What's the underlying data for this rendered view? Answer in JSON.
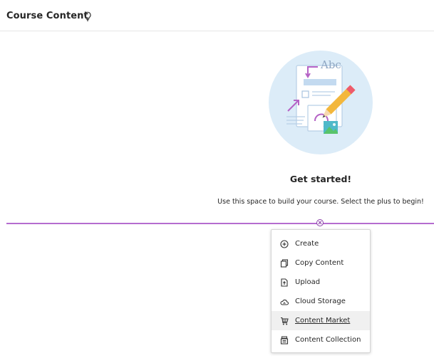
{
  "header": {
    "title": "Course Content",
    "icon": "lightbulb-icon"
  },
  "illustration": {
    "label": "Abc"
  },
  "empty_state": {
    "heading": "Get started!",
    "message": "Use this space to build your course. Select the plus to begin!"
  },
  "colors": {
    "accent": "#b56ccf",
    "illustration_bg": "#dcecf8",
    "pencil": "#f3b73c"
  },
  "menu": {
    "items": [
      {
        "label": "Create",
        "icon": "plus-circle-icon"
      },
      {
        "label": "Copy Content",
        "icon": "copy-icon"
      },
      {
        "label": "Upload",
        "icon": "upload-icon"
      },
      {
        "label": "Cloud Storage",
        "icon": "cloud-icon"
      },
      {
        "label": "Content Market",
        "icon": "cart-icon"
      },
      {
        "label": "Content Collection",
        "icon": "collection-icon"
      }
    ],
    "hovered_item": "Content Market"
  }
}
